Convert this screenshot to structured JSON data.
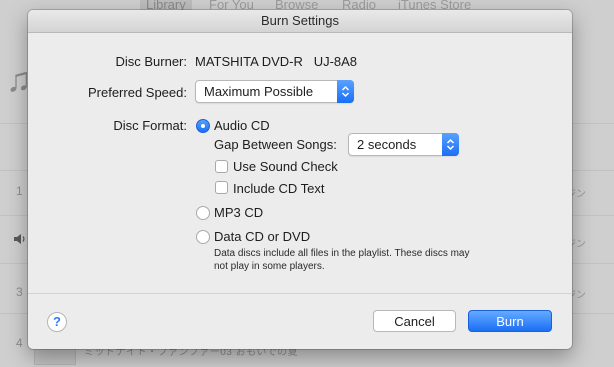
{
  "background": {
    "tabs": [
      "Library",
      "For You",
      "Browse",
      "Radio",
      "iTunes Store"
    ],
    "row_numbers": [
      "1",
      "3",
      "4"
    ],
    "row_suffix": "ジン",
    "bottom_text": "ミッドナイト・ファンファー03 おもいでの夏"
  },
  "dialog": {
    "title": "Burn Settings",
    "disc_burner_label": "Disc Burner:",
    "disc_burner_value": "MATSHITA DVD-R   UJ-8A8",
    "preferred_speed_label": "Preferred Speed:",
    "preferred_speed_value": "Maximum Possible",
    "disc_format_label": "Disc Format:",
    "audio_cd_label": "Audio CD",
    "audio_cd_selected": true,
    "gap_label": "Gap Between Songs:",
    "gap_value": "2 seconds",
    "use_sound_check_label": "Use Sound Check",
    "use_sound_check_checked": false,
    "include_cd_text_label": "Include CD Text",
    "include_cd_text_checked": false,
    "mp3_cd_label": "MP3 CD",
    "data_cd_label": "Data CD or DVD",
    "data_note": "Data discs include all files in the playlist. These discs may not play in some players.",
    "help_label": "?",
    "cancel_label": "Cancel",
    "burn_label": "Burn"
  },
  "colors": {
    "accent": "#1c6ff5",
    "sheet_bg": "#ececec",
    "background": "#cfcfcf"
  },
  "icons": {
    "popup_arrows": "chevron-up-down-icon",
    "background_music": "music-note-icon",
    "background_speaker": "speaker-icon"
  }
}
